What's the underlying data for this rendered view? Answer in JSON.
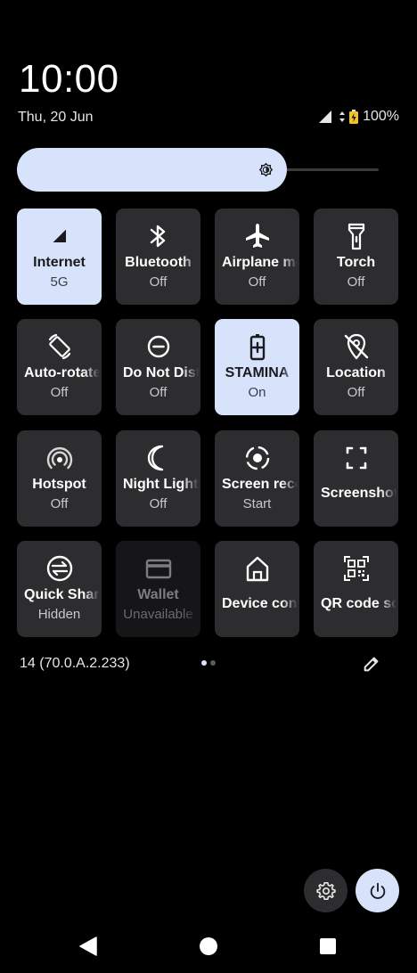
{
  "clock": {
    "time": "10:00",
    "date": "Thu, 20 Jun"
  },
  "status": {
    "battery": "100%"
  },
  "brightness": {
    "level": 0.73,
    "icon": "brightness-icon"
  },
  "tiles": [
    {
      "label": "Internet",
      "state": "5G",
      "icon": "signal-icon",
      "active": true
    },
    {
      "label": "Bluetooth",
      "state": "Off",
      "icon": "bluetooth-icon",
      "active": false
    },
    {
      "label": "Airplane mode",
      "state": "Off",
      "icon": "airplane-icon",
      "active": false
    },
    {
      "label": "Torch",
      "state": "Off",
      "icon": "torch-icon",
      "active": false
    },
    {
      "label": "Auto-rotate",
      "state": "Off",
      "icon": "auto-rotate-icon",
      "active": false
    },
    {
      "label": "Do Not Disturb",
      "state": "Off",
      "icon": "do-not-disturb-icon",
      "active": false
    },
    {
      "label": "STAMINA",
      "state": "On",
      "icon": "battery-saver-icon",
      "active": true
    },
    {
      "label": "Location",
      "state": "Off",
      "icon": "location-off-icon",
      "active": false
    },
    {
      "label": "Hotspot",
      "state": "Off",
      "icon": "hotspot-icon",
      "active": false
    },
    {
      "label": "Night Light",
      "state": "Off",
      "icon": "moon-icon",
      "active": false
    },
    {
      "label": "Screen record",
      "state": "Start",
      "icon": "screen-record-icon",
      "active": false
    },
    {
      "label": "Screenshot",
      "state": "",
      "icon": "screenshot-icon",
      "active": false
    },
    {
      "label": "Quick Share",
      "state": "Hidden",
      "icon": "quick-share-icon",
      "active": false
    },
    {
      "label": "Wallet",
      "state": "Unavailable",
      "icon": "wallet-icon",
      "active": false,
      "disabled": true
    },
    {
      "label": "Device controls",
      "state": "",
      "icon": "home-icon",
      "active": false
    },
    {
      "label": "QR code scanner",
      "state": "",
      "icon": "qr-code-icon",
      "active": false
    }
  ],
  "footer": {
    "build": "14 (70.0.A.2.233)",
    "page": 1,
    "pages": 2
  },
  "colors": {
    "accent": "#d7e3fb",
    "tile": "#2d2d2f",
    "background": "#000000"
  }
}
